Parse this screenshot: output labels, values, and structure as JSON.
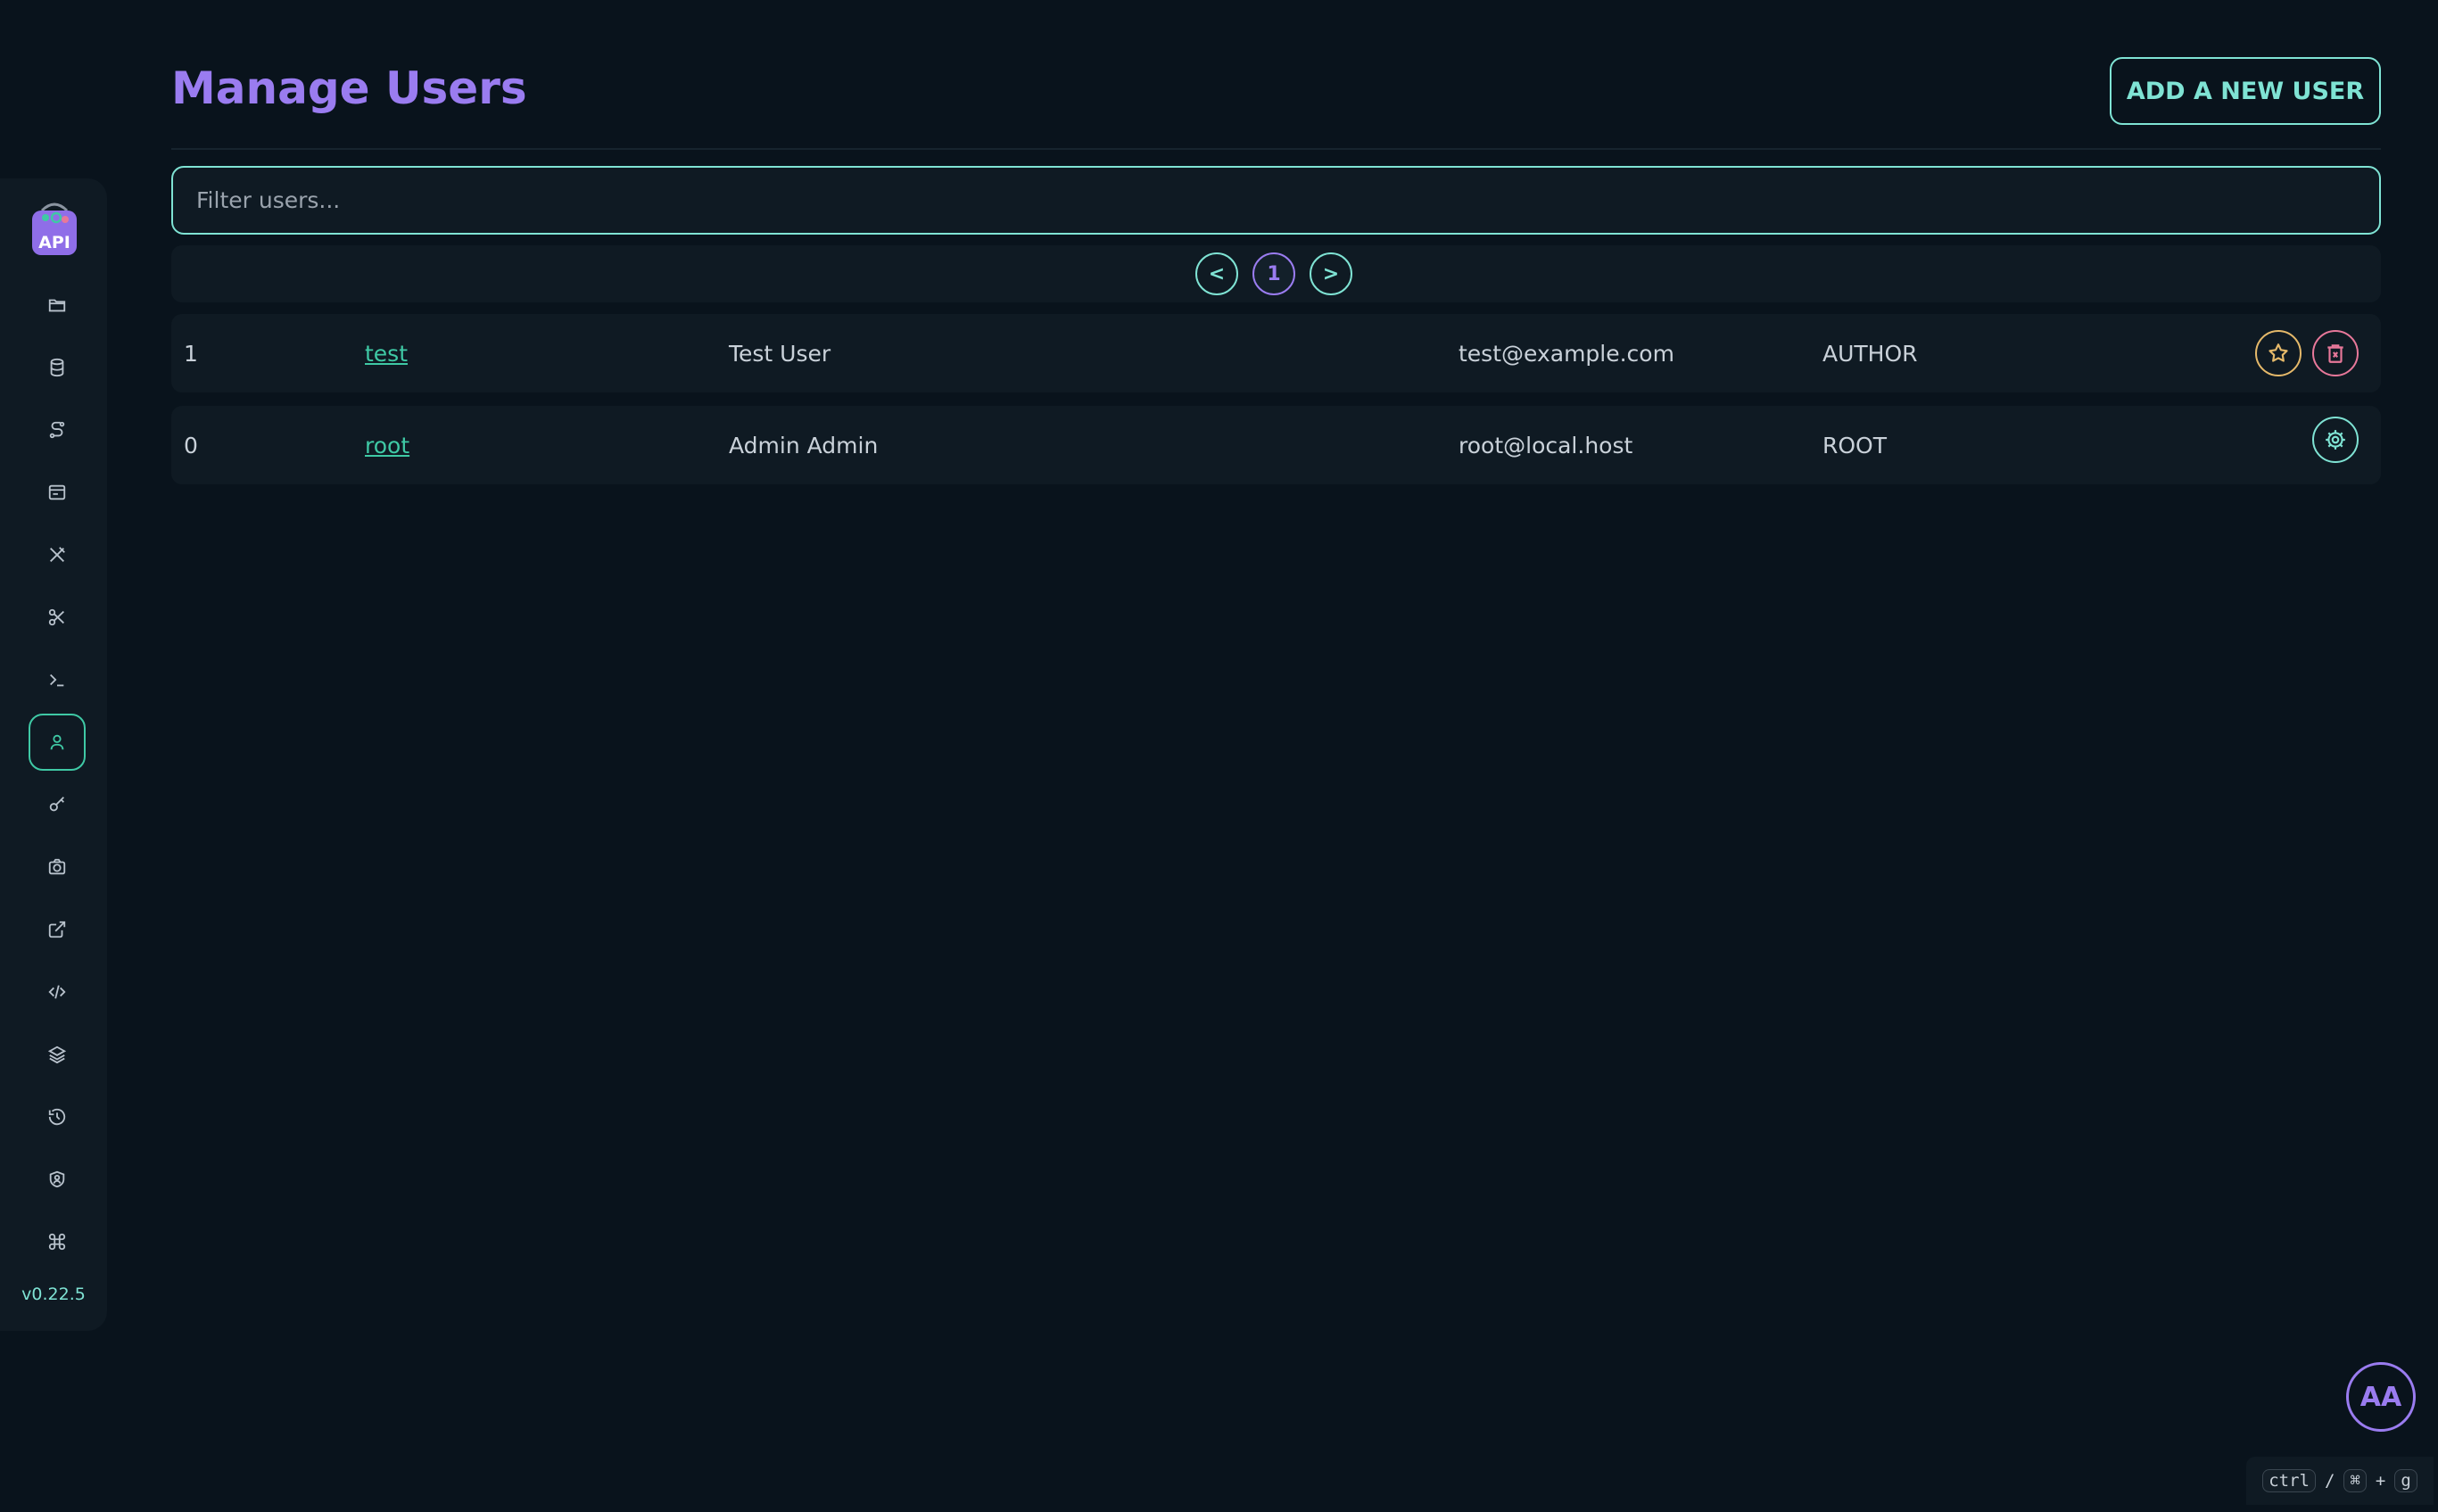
{
  "sidebar": {
    "logo_text": "API",
    "items": [
      {
        "icon": "folder-icon"
      },
      {
        "icon": "database-icon"
      },
      {
        "icon": "route-icon"
      },
      {
        "icon": "browser-window-icon"
      },
      {
        "icon": "tools-icon"
      },
      {
        "icon": "scissors-icon"
      },
      {
        "icon": "terminal-icon"
      },
      {
        "icon": "user-icon",
        "active": true
      },
      {
        "icon": "key-icon"
      },
      {
        "icon": "camera-icon"
      },
      {
        "icon": "external-link-icon"
      },
      {
        "icon": "code-icon"
      },
      {
        "icon": "layers-icon"
      },
      {
        "icon": "history-icon"
      },
      {
        "icon": "user-shield-icon"
      },
      {
        "icon": "command-icon"
      }
    ],
    "version": "v0.22.5"
  },
  "header": {
    "title": "Manage Users",
    "add_button": "ADD A NEW USER"
  },
  "filter": {
    "placeholder": "Filter users..."
  },
  "pagination": {
    "prev": "<",
    "current": "1",
    "next": ">"
  },
  "users": [
    {
      "id": "1",
      "username": "test",
      "name": "Test User",
      "email": "test@example.com",
      "role": "AUTHOR",
      "actions": [
        "star-icon",
        "trash-icon"
      ]
    },
    {
      "id": "0",
      "username": "root",
      "name": "Admin Admin",
      "email": "root@local.host",
      "role": "ROOT",
      "actions": [
        "gear-icon"
      ]
    }
  ],
  "font_button": "AA",
  "shortcut": {
    "key1": "ctrl",
    "sep": "/",
    "key2": "⌘",
    "plus": "+",
    "key3": "g"
  },
  "colors": {
    "background": "#09131c",
    "panel": "#0f1a23",
    "accent_teal": "#7fe3d4",
    "accent_green": "#3fc9a5",
    "accent_purple": "#9a7cf0",
    "star": "#e5b96a",
    "danger": "#e8789a"
  }
}
